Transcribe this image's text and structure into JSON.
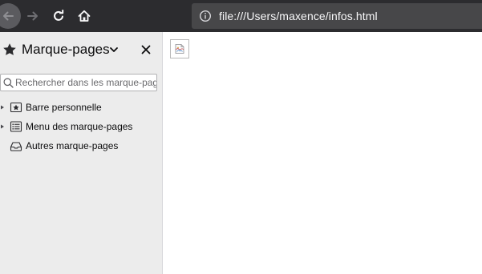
{
  "toolbar": {
    "back_icon": "arrow-left-icon",
    "forward_icon": "arrow-right-icon",
    "reload_icon": "reload-icon",
    "home_icon": "home-icon",
    "url": "file:///Users/maxence/infos.html",
    "info_icon": "info-icon"
  },
  "sidebar": {
    "title": "Marque-pages",
    "search": {
      "placeholder": "Rechercher dans les marque-pages",
      "value": ""
    },
    "items": [
      {
        "label": "Barre personnelle",
        "icon": "bookmarks-toolbar-icon",
        "expandable": true
      },
      {
        "label": "Menu des marque-pages",
        "icon": "bookmarks-menu-icon",
        "expandable": true
      },
      {
        "label": "Autres marque-pages",
        "icon": "other-bookmarks-icon",
        "expandable": false
      }
    ]
  },
  "content": {
    "image_state": "broken-image-icon"
  },
  "colors": {
    "toolbar_bg": "#2c2c2f",
    "urlbar_bg": "#474749",
    "sidebar_bg": "#ececec",
    "content_bg": "#ffffff"
  }
}
